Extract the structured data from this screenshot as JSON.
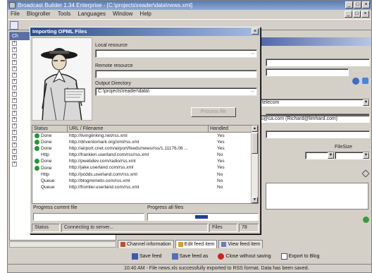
{
  "window": {
    "title": "Broadcast Builder 1.34 Enterprise - [C:\\projects\\reader\\data\\news.xml]"
  },
  "menu": [
    "File",
    "Blogroller",
    "Tools",
    "Languages",
    "Window",
    "Help"
  ],
  "left_panel": {
    "header": "Ch"
  },
  "right_panel": {
    "dropdown_value": "e telecom",
    "email_value": "bs@ca.com (Richard@limhard.com)",
    "filesize_label": "FileSize"
  },
  "dialog": {
    "title": "Importing OPML Files",
    "local_resource_label": "Local resource",
    "local_resource_value": "",
    "remote_resource_label": "Remote resource",
    "remote_resource_value": "",
    "output_dir_label": "Output Directory",
    "output_dir_value": "C:\\projects\\reader\\data\\",
    "browse_glyph": "...",
    "process_button": "Process file",
    "list": {
      "headers": [
        "Status",
        "URL / Filename",
        "Handled"
      ],
      "rows": [
        {
          "status": "Done",
          "ok": true,
          "url": "http://livinglinking.net/rss.xml",
          "handled": "Yes"
        },
        {
          "status": "Done",
          "ok": true,
          "url": "http://driventomark.org/xml/rss.xml",
          "handled": "Yes"
        },
        {
          "status": "Done",
          "ok": true,
          "url": "http://airport.cnet.com/airport/feeds/news/rss/1,11176,06 ...",
          "handled": "Yes"
        },
        {
          "status": "Http",
          "ok": false,
          "url": "http://frankien.userland.com/rss/rss.xml",
          "handled": "No"
        },
        {
          "status": "Done",
          "ok": true,
          "url": "http://pwebdev.com/radio/rss.xml",
          "handled": "Yes"
        },
        {
          "status": "Done",
          "ok": true,
          "url": "http://jake.userland.com/rss.xml",
          "handled": "Yes"
        },
        {
          "status": "Http",
          "ok": false,
          "url": "http://pcdds.userland.com/rss.xml",
          "handled": "No"
        },
        {
          "status": "Queue",
          "ok": false,
          "url": "http://blogmimeto.com/rss.xml",
          "handled": "No"
        },
        {
          "status": "Queue",
          "ok": false,
          "url": "http://frontier.userland.com/rss.xml",
          "handled": "No"
        }
      ]
    },
    "progress_current_label": "Progress current file",
    "progress_current": 0,
    "progress_all_label": "Progress all files",
    "progress_all": 0.12,
    "status_label": "Status",
    "status_value": "Connecting to server...",
    "files_label": "Files",
    "files_value": "78"
  },
  "tabs": [
    "Channel information",
    "Edit feed item",
    "View feed item"
  ],
  "actions": [
    "Save feed",
    "Save feed as",
    "Close without saving",
    "Export to Blog"
  ],
  "statusbar": {
    "text": "10:40 AM - File news.xls successfully exported to RSS format. Data has been saved."
  },
  "colors": {
    "titlebar": "#5a7ab0",
    "dialog_title": "#2a4a8c",
    "ok_status": "#1e9a2a",
    "progress": "#1f3f9a"
  }
}
